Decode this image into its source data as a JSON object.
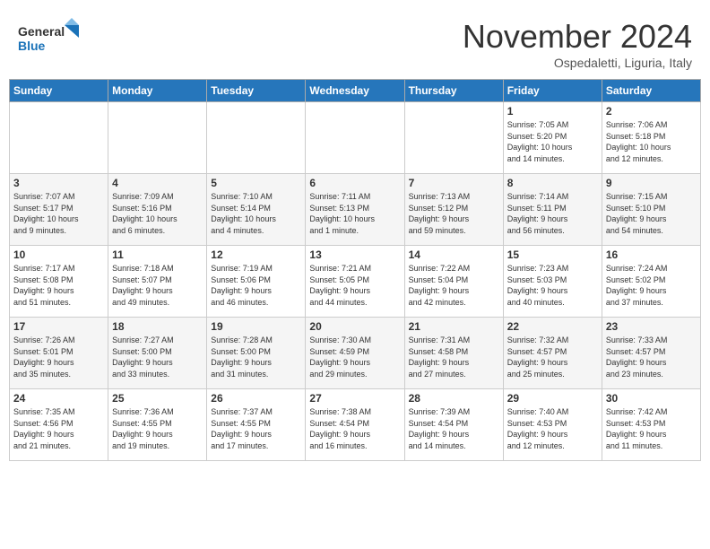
{
  "header": {
    "logo_general": "General",
    "logo_blue": "Blue",
    "month": "November 2024",
    "location": "Ospedaletti, Liguria, Italy"
  },
  "weekdays": [
    "Sunday",
    "Monday",
    "Tuesday",
    "Wednesday",
    "Thursday",
    "Friday",
    "Saturday"
  ],
  "weeks": [
    [
      {
        "day": "",
        "info": ""
      },
      {
        "day": "",
        "info": ""
      },
      {
        "day": "",
        "info": ""
      },
      {
        "day": "",
        "info": ""
      },
      {
        "day": "",
        "info": ""
      },
      {
        "day": "1",
        "info": "Sunrise: 7:05 AM\nSunset: 5:20 PM\nDaylight: 10 hours\nand 14 minutes."
      },
      {
        "day": "2",
        "info": "Sunrise: 7:06 AM\nSunset: 5:18 PM\nDaylight: 10 hours\nand 12 minutes."
      }
    ],
    [
      {
        "day": "3",
        "info": "Sunrise: 7:07 AM\nSunset: 5:17 PM\nDaylight: 10 hours\nand 9 minutes."
      },
      {
        "day": "4",
        "info": "Sunrise: 7:09 AM\nSunset: 5:16 PM\nDaylight: 10 hours\nand 6 minutes."
      },
      {
        "day": "5",
        "info": "Sunrise: 7:10 AM\nSunset: 5:14 PM\nDaylight: 10 hours\nand 4 minutes."
      },
      {
        "day": "6",
        "info": "Sunrise: 7:11 AM\nSunset: 5:13 PM\nDaylight: 10 hours\nand 1 minute."
      },
      {
        "day": "7",
        "info": "Sunrise: 7:13 AM\nSunset: 5:12 PM\nDaylight: 9 hours\nand 59 minutes."
      },
      {
        "day": "8",
        "info": "Sunrise: 7:14 AM\nSunset: 5:11 PM\nDaylight: 9 hours\nand 56 minutes."
      },
      {
        "day": "9",
        "info": "Sunrise: 7:15 AM\nSunset: 5:10 PM\nDaylight: 9 hours\nand 54 minutes."
      }
    ],
    [
      {
        "day": "10",
        "info": "Sunrise: 7:17 AM\nSunset: 5:08 PM\nDaylight: 9 hours\nand 51 minutes."
      },
      {
        "day": "11",
        "info": "Sunrise: 7:18 AM\nSunset: 5:07 PM\nDaylight: 9 hours\nand 49 minutes."
      },
      {
        "day": "12",
        "info": "Sunrise: 7:19 AM\nSunset: 5:06 PM\nDaylight: 9 hours\nand 46 minutes."
      },
      {
        "day": "13",
        "info": "Sunrise: 7:21 AM\nSunset: 5:05 PM\nDaylight: 9 hours\nand 44 minutes."
      },
      {
        "day": "14",
        "info": "Sunrise: 7:22 AM\nSunset: 5:04 PM\nDaylight: 9 hours\nand 42 minutes."
      },
      {
        "day": "15",
        "info": "Sunrise: 7:23 AM\nSunset: 5:03 PM\nDaylight: 9 hours\nand 40 minutes."
      },
      {
        "day": "16",
        "info": "Sunrise: 7:24 AM\nSunset: 5:02 PM\nDaylight: 9 hours\nand 37 minutes."
      }
    ],
    [
      {
        "day": "17",
        "info": "Sunrise: 7:26 AM\nSunset: 5:01 PM\nDaylight: 9 hours\nand 35 minutes."
      },
      {
        "day": "18",
        "info": "Sunrise: 7:27 AM\nSunset: 5:00 PM\nDaylight: 9 hours\nand 33 minutes."
      },
      {
        "day": "19",
        "info": "Sunrise: 7:28 AM\nSunset: 5:00 PM\nDaylight: 9 hours\nand 31 minutes."
      },
      {
        "day": "20",
        "info": "Sunrise: 7:30 AM\nSunset: 4:59 PM\nDaylight: 9 hours\nand 29 minutes."
      },
      {
        "day": "21",
        "info": "Sunrise: 7:31 AM\nSunset: 4:58 PM\nDaylight: 9 hours\nand 27 minutes."
      },
      {
        "day": "22",
        "info": "Sunrise: 7:32 AM\nSunset: 4:57 PM\nDaylight: 9 hours\nand 25 minutes."
      },
      {
        "day": "23",
        "info": "Sunrise: 7:33 AM\nSunset: 4:57 PM\nDaylight: 9 hours\nand 23 minutes."
      }
    ],
    [
      {
        "day": "24",
        "info": "Sunrise: 7:35 AM\nSunset: 4:56 PM\nDaylight: 9 hours\nand 21 minutes."
      },
      {
        "day": "25",
        "info": "Sunrise: 7:36 AM\nSunset: 4:55 PM\nDaylight: 9 hours\nand 19 minutes."
      },
      {
        "day": "26",
        "info": "Sunrise: 7:37 AM\nSunset: 4:55 PM\nDaylight: 9 hours\nand 17 minutes."
      },
      {
        "day": "27",
        "info": "Sunrise: 7:38 AM\nSunset: 4:54 PM\nDaylight: 9 hours\nand 16 minutes."
      },
      {
        "day": "28",
        "info": "Sunrise: 7:39 AM\nSunset: 4:54 PM\nDaylight: 9 hours\nand 14 minutes."
      },
      {
        "day": "29",
        "info": "Sunrise: 7:40 AM\nSunset: 4:53 PM\nDaylight: 9 hours\nand 12 minutes."
      },
      {
        "day": "30",
        "info": "Sunrise: 7:42 AM\nSunset: 4:53 PM\nDaylight: 9 hours\nand 11 minutes."
      }
    ]
  ]
}
